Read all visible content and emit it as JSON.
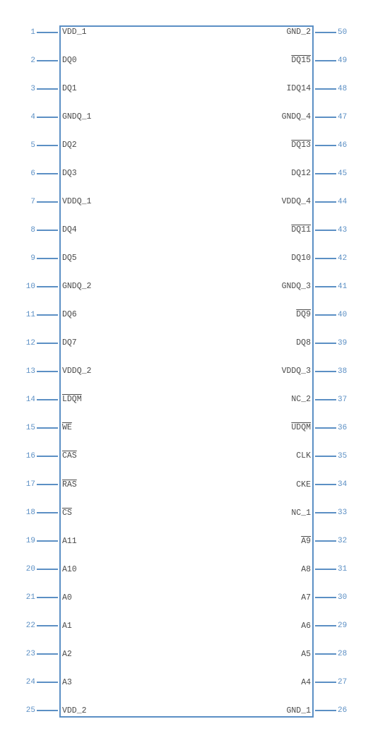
{
  "pins": [
    {
      "num_left": "1",
      "label_left": "VDD_1",
      "num_right": "50",
      "label_right": "GND_2",
      "right_bar": false,
      "left_bar": false
    },
    {
      "num_left": "2",
      "label_left": "DQ0",
      "num_right": "49",
      "label_right": "DQ15",
      "right_bar": true,
      "left_bar": false
    },
    {
      "num_left": "3",
      "label_left": "DQ1",
      "num_right": "48",
      "label_right": "IDQ14",
      "right_bar": false,
      "left_bar": false
    },
    {
      "num_left": "4",
      "label_left": "GNDQ_1",
      "num_right": "47",
      "label_right": "GNDQ_4",
      "right_bar": false,
      "left_bar": false
    },
    {
      "num_left": "5",
      "label_left": "DQ2",
      "num_right": "46",
      "label_right": "DQ13",
      "right_bar": true,
      "left_bar": false
    },
    {
      "num_left": "6",
      "label_left": "DQ3",
      "num_right": "45",
      "label_right": "DQ12",
      "right_bar": false,
      "left_bar": false
    },
    {
      "num_left": "7",
      "label_left": "VDDQ_1",
      "num_right": "44",
      "label_right": "VDDQ_4",
      "right_bar": false,
      "left_bar": false
    },
    {
      "num_left": "8",
      "label_left": "DQ4",
      "num_right": "43",
      "label_right": "DQ11",
      "right_bar": true,
      "left_bar": false
    },
    {
      "num_left": "9",
      "label_left": "DQ5",
      "num_right": "42",
      "label_right": "DQ10",
      "right_bar": false,
      "left_bar": false
    },
    {
      "num_left": "10",
      "label_left": "GNDQ_2",
      "num_right": "41",
      "label_right": "GNDQ_3",
      "right_bar": false,
      "left_bar": false
    },
    {
      "num_left": "11",
      "label_left": "DQ6",
      "num_right": "40",
      "label_right": "DQ9",
      "right_bar": true,
      "left_bar": false
    },
    {
      "num_left": "12",
      "label_left": "DQ7",
      "num_right": "39",
      "label_right": "DQ8",
      "right_bar": false,
      "left_bar": false
    },
    {
      "num_left": "13",
      "label_left": "VDDQ_2",
      "num_right": "38",
      "label_right": "VDDQ_3",
      "right_bar": false,
      "left_bar": false
    },
    {
      "num_left": "14",
      "label_left": "LDQM",
      "num_right": "37",
      "label_right": "NC_2",
      "right_bar": false,
      "left_bar": true
    },
    {
      "num_left": "15",
      "label_left": "WE",
      "num_right": "36",
      "label_right": "UDQM",
      "right_bar": true,
      "left_bar": true
    },
    {
      "num_left": "16",
      "label_left": "CAS",
      "num_right": "35",
      "label_right": "CLK",
      "right_bar": false,
      "left_bar": true
    },
    {
      "num_left": "17",
      "label_left": "RAS",
      "num_right": "34",
      "label_right": "CKE",
      "right_bar": false,
      "left_bar": true
    },
    {
      "num_left": "18",
      "label_left": "CS",
      "num_right": "33",
      "label_right": "NC_1",
      "right_bar": false,
      "left_bar": true
    },
    {
      "num_left": "19",
      "label_left": "A11",
      "num_right": "32",
      "label_right": "A9",
      "right_bar": true,
      "left_bar": false
    },
    {
      "num_left": "20",
      "label_left": "A10",
      "num_right": "31",
      "label_right": "A8",
      "right_bar": false,
      "left_bar": false
    },
    {
      "num_left": "21",
      "label_left": "A0",
      "num_right": "30",
      "label_right": "A7",
      "right_bar": false,
      "left_bar": false
    },
    {
      "num_left": "22",
      "label_left": "A1",
      "num_right": "29",
      "label_right": "A6",
      "right_bar": false,
      "left_bar": false
    },
    {
      "num_left": "23",
      "label_left": "A2",
      "num_right": "28",
      "label_right": "A5",
      "right_bar": false,
      "left_bar": false
    },
    {
      "num_left": "24",
      "label_left": "A3",
      "num_right": "27",
      "label_right": "A4",
      "right_bar": false,
      "left_bar": false
    },
    {
      "num_left": "25",
      "label_left": "VDD_2",
      "num_right": "26",
      "label_right": "GND_1",
      "right_bar": false,
      "left_bar": false
    }
  ],
  "colors": {
    "pin_line": "#5b8fc4",
    "pin_num": "#5b8fc4",
    "pin_label": "#4a4a4a",
    "body_border": "#5b8fc4"
  }
}
